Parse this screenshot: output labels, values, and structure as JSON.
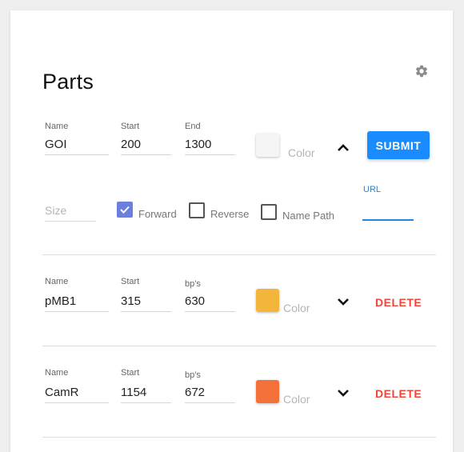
{
  "page": {
    "title": "Parts"
  },
  "new_part": {
    "name_label": "Name",
    "name_value": "GOI",
    "start_label": "Start",
    "start_value": "200",
    "end_label": "End",
    "end_value": "1300",
    "color_placeholder": "Color",
    "color_value": "#f5f5f5",
    "submit_label": "SUBMIT",
    "size_placeholder": "Size",
    "forward_label": "Forward",
    "forward_checked": true,
    "reverse_label": "Reverse",
    "reverse_checked": false,
    "name_path_label": "Name Path",
    "name_path_checked": false,
    "url_label": "URL",
    "url_value": ""
  },
  "parts": [
    {
      "name_label": "Name",
      "name_value": "pMB1",
      "start_label": "Start",
      "start_value": "315",
      "bps_label": "bp's",
      "bps_value": "630",
      "color_placeholder": "Color",
      "color_value": "#f4b63a",
      "delete_label": "DELETE"
    },
    {
      "name_label": "Name",
      "name_value": "CamR",
      "start_label": "Start",
      "start_value": "1154",
      "bps_label": "bp's",
      "bps_value": "672",
      "color_placeholder": "Color",
      "color_value": "#f4713a",
      "delete_label": "DELETE"
    }
  ],
  "icons": {
    "settings": "gear-icon",
    "collapse": "chevron-up-icon",
    "expand": "chevron-down-icon"
  },
  "colors": {
    "accent": "#1a8cff",
    "danger": "#f44336",
    "checkbox": "#6a7fe0"
  }
}
